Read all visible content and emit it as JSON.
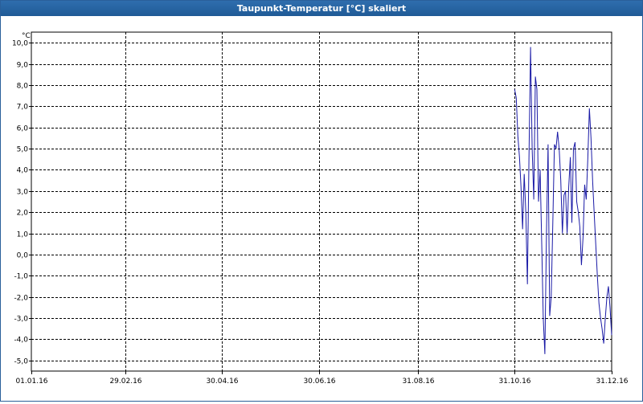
{
  "window": {
    "title": "Taupunkt-Temperatur [°C] skaliert"
  },
  "chart_data": {
    "type": "line",
    "title": "Taupunkt-Temperatur [°C] skaliert",
    "ylabel": "°C",
    "ylim": [
      -5.5,
      10.5
    ],
    "xlim": [
      "2016-01-01",
      "2016-12-31"
    ],
    "y_ticks": [
      10.0,
      9.0,
      8.0,
      7.0,
      6.0,
      5.0,
      4.0,
      3.0,
      2.0,
      1.0,
      0.0,
      -1.0,
      -2.0,
      -3.0,
      -4.0,
      -5.0
    ],
    "y_tick_labels": [
      "10,0",
      "9,0",
      "8,0",
      "7,0",
      "6,0",
      "5,0",
      "4,0",
      "3,0",
      "2,0",
      "1,0",
      "0,0",
      "-1,0",
      "-2,0",
      "-3,0",
      "-4,0",
      "-5,0"
    ],
    "x_ticks": [
      "2016-01-01",
      "2016-02-29",
      "2016-04-30",
      "2016-06-30",
      "2016-08-31",
      "2016-10-31",
      "2016-12-31"
    ],
    "x_tick_labels": [
      "01.01.16",
      "29.02.16",
      "30.04.16",
      "30.06.16",
      "31.08.16",
      "31.10.16",
      "31.12.16"
    ],
    "grid": true,
    "colors": {
      "series": "#1a1aa6",
      "grid": "#000000"
    },
    "series": [
      {
        "x": [
          "2016-10-31",
          "2016-11-01",
          "2016-11-02",
          "2016-11-03",
          "2016-11-04",
          "2016-11-05",
          "2016-11-06",
          "2016-11-07",
          "2016-11-08",
          "2016-11-09",
          "2016-11-10",
          "2016-11-11",
          "2016-11-12",
          "2016-11-13",
          "2016-11-14",
          "2016-11-15",
          "2016-11-16",
          "2016-11-17",
          "2016-11-18",
          "2016-11-19",
          "2016-11-20",
          "2016-11-21",
          "2016-11-22",
          "2016-11-23",
          "2016-11-24",
          "2016-11-25",
          "2016-11-26",
          "2016-11-27",
          "2016-11-28",
          "2016-11-29",
          "2016-11-30",
          "2016-12-01",
          "2016-12-02",
          "2016-12-03",
          "2016-12-04",
          "2016-12-05",
          "2016-12-06",
          "2016-12-07",
          "2016-12-08",
          "2016-12-09",
          "2016-12-10",
          "2016-12-11",
          "2016-12-12",
          "2016-12-13",
          "2016-12-14",
          "2016-12-15",
          "2016-12-16",
          "2016-12-17",
          "2016-12-18",
          "2016-12-19",
          "2016-12-20",
          "2016-12-21",
          "2016-12-22",
          "2016-12-23",
          "2016-12-24",
          "2016-12-25",
          "2016-12-26",
          "2016-12-27",
          "2016-12-28",
          "2016-12-29",
          "2016-12-30",
          "2016-12-31"
        ],
        "values": [
          7.8,
          7.4,
          5.6,
          4.6,
          3.2,
          1.2,
          3.8,
          2.0,
          -1.4,
          4.5,
          9.8,
          5.0,
          2.6,
          8.4,
          7.8,
          2.5,
          4.0,
          0.5,
          -3.0,
          -4.7,
          1.0,
          5.2,
          -2.9,
          -2.0,
          1.5,
          5.2,
          5.0,
          5.8,
          5.0,
          3.5,
          1.0,
          2.8,
          3.0,
          1.0,
          3.2,
          4.6,
          1.5,
          5.0,
          5.3,
          2.5,
          2.0,
          1.3,
          -0.5,
          0.8,
          3.3,
          2.6,
          4.5,
          6.9,
          5.5,
          3.5,
          2.0,
          0.5,
          -1.0,
          -2.3,
          -3.0,
          -3.5,
          -4.2,
          -3.0,
          -2.0,
          -1.5,
          -2.5,
          -3.8
        ]
      }
    ]
  }
}
